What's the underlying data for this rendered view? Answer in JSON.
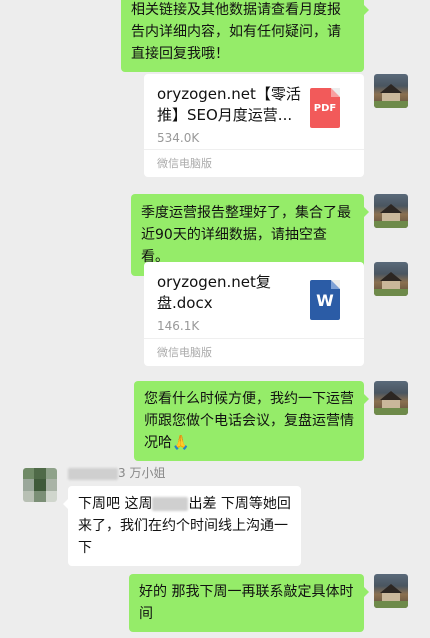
{
  "messages": {
    "m1": {
      "text": "相关链接及其他数据请查看月度报告内详细内容，如有任何疑问，请直接回复我哦！"
    },
    "file1": {
      "name": "oryzogen.net【零活推】SEO月度运营...",
      "size": "534.0K",
      "source": "微信电脑版",
      "icon_label": "PDF"
    },
    "m2": {
      "text": "季度运营报告整理好了，集合了最近90天的详细数据，请抽空查看。"
    },
    "file2": {
      "name": "oryzogen.net复盘.docx",
      "size": "146.1K",
      "source": "微信电脑版",
      "icon_label": "W"
    },
    "m3": {
      "text": "您看什么时候方便，我约一下运营师跟您做个电话会议，复盘运营情况哈",
      "emoji": "🙏"
    },
    "m4": {
      "sender_suffix": "3 万小姐",
      "text_a": "下周吧   这周",
      "text_b": "出差 下周等她回来了，我们在约个时间线上沟通一下"
    },
    "m5": {
      "text": "好的 那我下周一再联系敲定具体时间"
    }
  },
  "colors": {
    "my_bubble": "#95ec69",
    "their_bubble": "#ffffff",
    "background": "#ededed"
  }
}
